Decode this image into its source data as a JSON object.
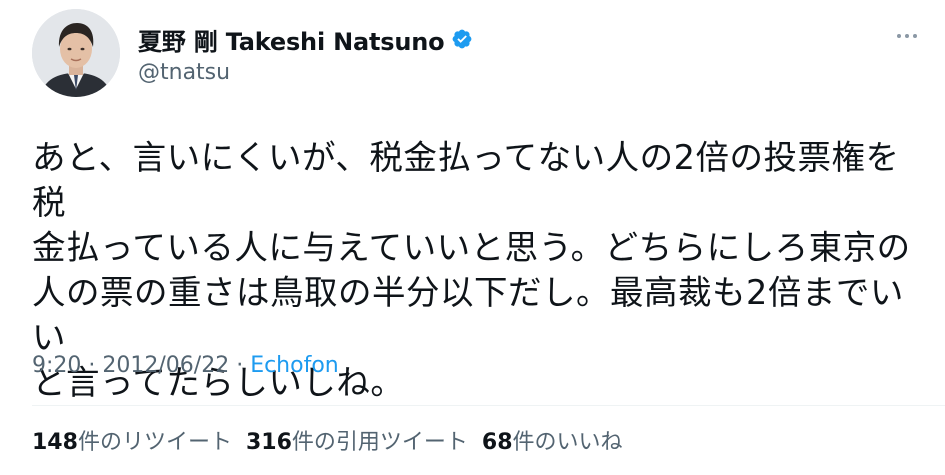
{
  "author": {
    "display_name": "夏野 剛 Takeshi Natsuno",
    "handle": "@tnatsu",
    "verified": true,
    "verified_icon": "verified-badge-icon",
    "avatar_icon": "profile-photo"
  },
  "tweet": {
    "text": "あと、言いにくいが、税金払ってない人の2倍の投票権を税\n金払っている人に与えていいと思う。どちらにしろ東京の\n人の票の重さは鳥取の半分以下だし。最高裁も2倍までいい\nと言ってたらしいしね。"
  },
  "meta": {
    "time": "9:20",
    "separator1": " · ",
    "date": "2012/06/22",
    "separator2": " · ",
    "source": "Echofon"
  },
  "stats": {
    "retweets_count": "148",
    "retweets_label": "件のリツイート",
    "quotes_count": "316",
    "quotes_label": "件の引用ツイート",
    "likes_count": "68",
    "likes_label": "件のいいね"
  },
  "colors": {
    "text": "#0f1419",
    "secondary": "#536471",
    "accent": "#1d9bf0",
    "divider": "#eff3f4"
  }
}
